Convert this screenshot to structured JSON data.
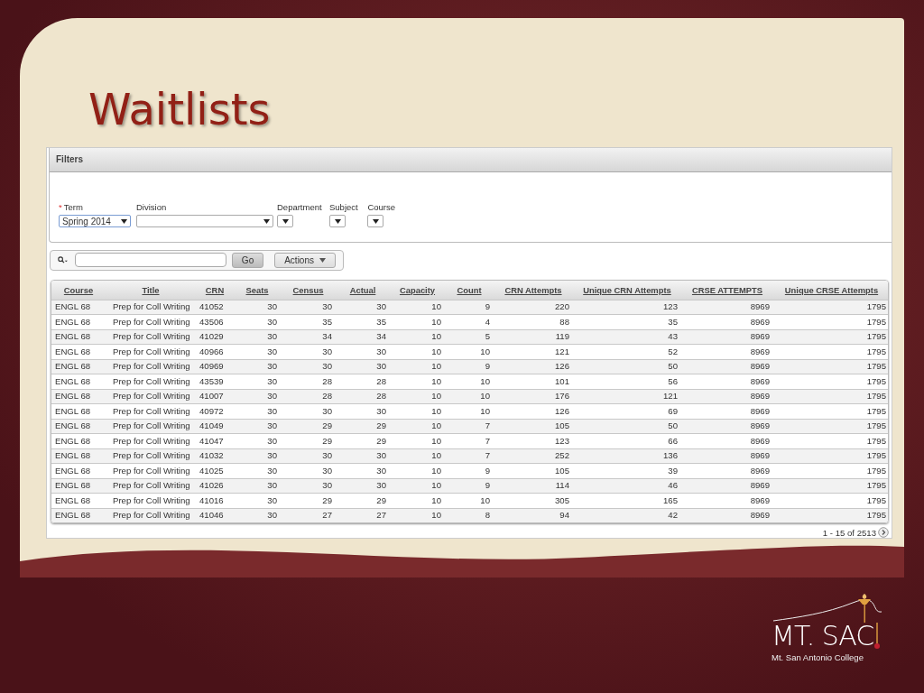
{
  "slide": {
    "title": "Waitlists"
  },
  "filters": {
    "heading": "Filters",
    "fields": [
      {
        "label": "Term",
        "required": true,
        "required_mark": "*",
        "value": "Spring 2014",
        "kind": "medium"
      },
      {
        "label": "Division",
        "required": false,
        "kind": "wide"
      },
      {
        "label": "Department",
        "required": false,
        "kind": "small"
      },
      {
        "label": "Subject",
        "required": false,
        "kind": "small"
      },
      {
        "label": "Course",
        "required": false,
        "kind": "small"
      }
    ]
  },
  "search": {
    "go_button": "Go",
    "actions_button": "Actions"
  },
  "table": {
    "columns": [
      "Course",
      "Title",
      "CRN",
      "Seats",
      "Census",
      "Actual",
      "Capacity",
      "Count",
      "CRN Attempts",
      "Unique CRN Attempts",
      "CRSE ATTEMPTS",
      "Unique CRSE Attempts"
    ],
    "rows": [
      [
        "ENGL 68",
        "Prep for Coll Writing",
        "41052",
        "30",
        "30",
        "30",
        "10",
        "9",
        "220",
        "123",
        "8969",
        "1795"
      ],
      [
        "ENGL 68",
        "Prep for Coll Writing",
        "43506",
        "30",
        "35",
        "35",
        "10",
        "4",
        "88",
        "35",
        "8969",
        "1795"
      ],
      [
        "ENGL 68",
        "Prep for Coll Writing",
        "41029",
        "30",
        "34",
        "34",
        "10",
        "5",
        "119",
        "43",
        "8969",
        "1795"
      ],
      [
        "ENGL 68",
        "Prep for Coll Writing",
        "40966",
        "30",
        "30",
        "30",
        "10",
        "10",
        "121",
        "52",
        "8969",
        "1795"
      ],
      [
        "ENGL 68",
        "Prep for Coll Writing",
        "40969",
        "30",
        "30",
        "30",
        "10",
        "9",
        "126",
        "50",
        "8969",
        "1795"
      ],
      [
        "ENGL 68",
        "Prep for Coll Writing",
        "43539",
        "30",
        "28",
        "28",
        "10",
        "10",
        "101",
        "56",
        "8969",
        "1795"
      ],
      [
        "ENGL 68",
        "Prep for Coll Writing",
        "41007",
        "30",
        "28",
        "28",
        "10",
        "10",
        "176",
        "121",
        "8969",
        "1795"
      ],
      [
        "ENGL 68",
        "Prep for Coll Writing",
        "40972",
        "30",
        "30",
        "30",
        "10",
        "10",
        "126",
        "69",
        "8969",
        "1795"
      ],
      [
        "ENGL 68",
        "Prep for Coll Writing",
        "41049",
        "30",
        "29",
        "29",
        "10",
        "7",
        "105",
        "50",
        "8969",
        "1795"
      ],
      [
        "ENGL 68",
        "Prep for Coll Writing",
        "41047",
        "30",
        "29",
        "29",
        "10",
        "7",
        "123",
        "66",
        "8969",
        "1795"
      ],
      [
        "ENGL 68",
        "Prep for Coll Writing",
        "41032",
        "30",
        "30",
        "30",
        "10",
        "7",
        "252",
        "136",
        "8969",
        "1795"
      ],
      [
        "ENGL 68",
        "Prep for Coll Writing",
        "41025",
        "30",
        "30",
        "30",
        "10",
        "9",
        "105",
        "39",
        "8969",
        "1795"
      ],
      [
        "ENGL 68",
        "Prep for Coll Writing",
        "41026",
        "30",
        "30",
        "30",
        "10",
        "9",
        "114",
        "46",
        "8969",
        "1795"
      ],
      [
        "ENGL 68",
        "Prep for Coll Writing",
        "41016",
        "30",
        "29",
        "29",
        "10",
        "10",
        "305",
        "165",
        "8969",
        "1795"
      ],
      [
        "ENGL 68",
        "Prep for Coll Writing",
        "41046",
        "30",
        "27",
        "27",
        "10",
        "8",
        "94",
        "42",
        "8969",
        "1795"
      ]
    ],
    "pagination": "1 - 15 of 2513"
  },
  "logo": {
    "name": "MT. SAC",
    "subtitle": "Mt. San Antonio College"
  }
}
